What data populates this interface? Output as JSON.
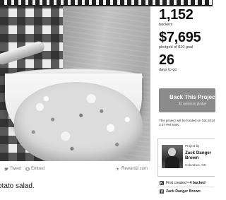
{
  "stats": {
    "backers": {
      "value": "1,152",
      "label": "backers"
    },
    "pledged": {
      "value": "$7,695",
      "label": "pledged of $10 goal"
    },
    "days": {
      "value": "26",
      "label": "days to go"
    }
  },
  "cta": {
    "label": "Back This Project",
    "sub": "$1 minimum pledge"
  },
  "funding_note": "This project will be funded on Sat 2014 3:47 PM MSK.",
  "creator": {
    "project_by": "Project by",
    "name": "Zack Danger Brown",
    "location": "Columbus, OH"
  },
  "creator_links": {
    "first_created": "First created",
    "backed": "4 backed",
    "facebook": "Zack Danger Brown"
  },
  "share": {
    "tweet": "Tweet",
    "embed": "Embed",
    "link": "Reward2.com"
  },
  "caption": "otato salad."
}
